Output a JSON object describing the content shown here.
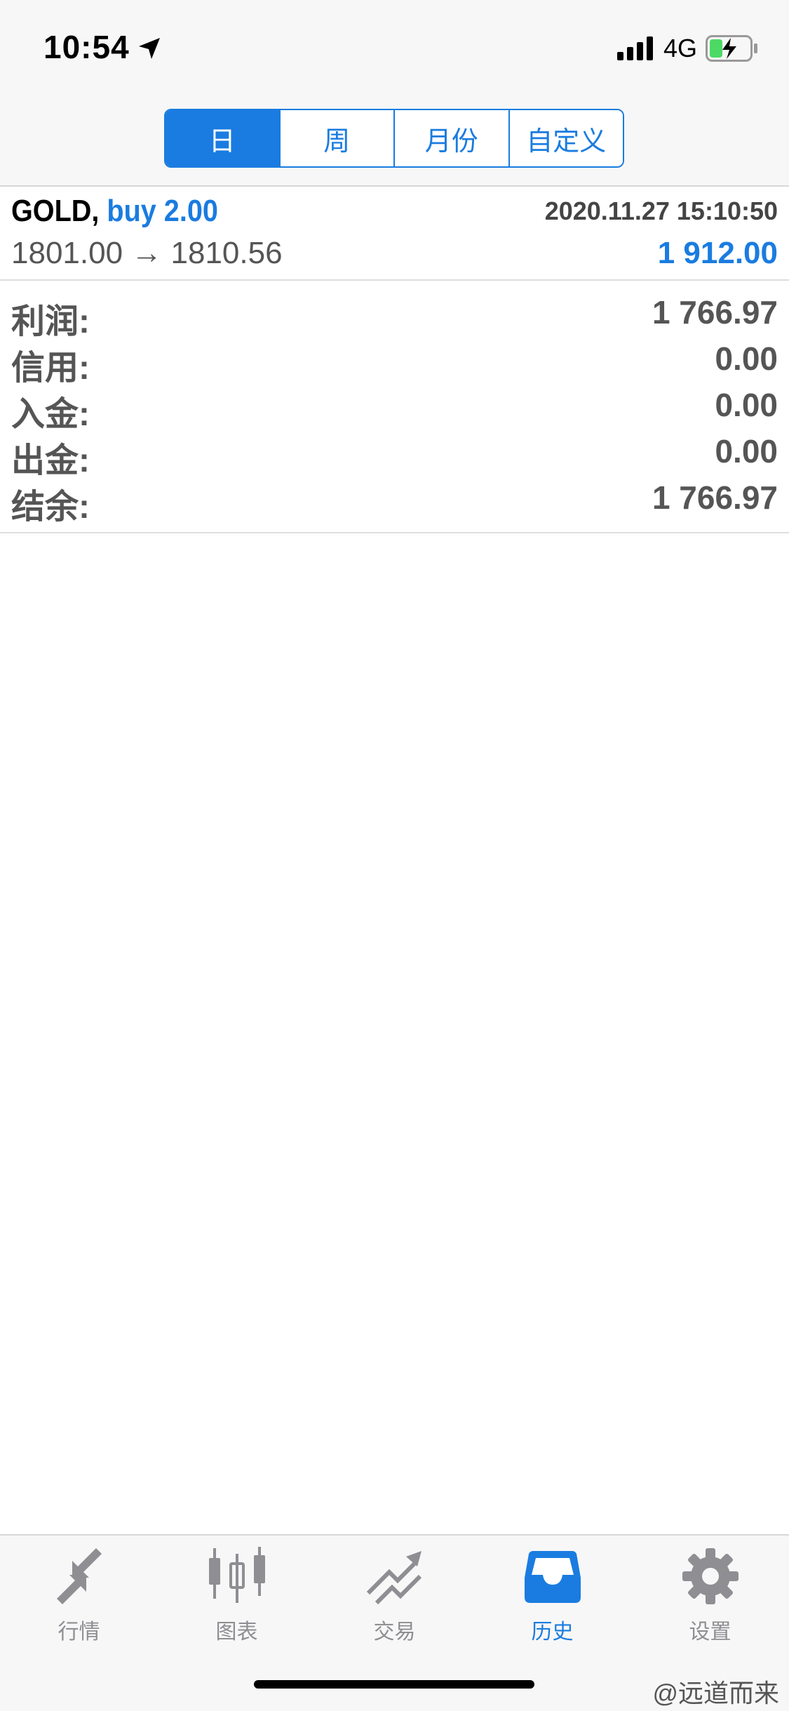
{
  "status_bar": {
    "time": "10:54",
    "network": "4G"
  },
  "segments": [
    {
      "label": "日",
      "active": true
    },
    {
      "label": "周",
      "active": false
    },
    {
      "label": "月份",
      "active": false
    },
    {
      "label": "自定义",
      "active": false
    }
  ],
  "deal": {
    "symbol": "GOLD,",
    "type": "buy 2.00",
    "time": "2020.11.27 15:10:50",
    "prices": "1801.00 → 1810.56",
    "profit": "1 912.00"
  },
  "summary": [
    {
      "label": "利润:",
      "value": "1 766.97"
    },
    {
      "label": "信用:",
      "value": "0.00"
    },
    {
      "label": "入金:",
      "value": "0.00"
    },
    {
      "label": "出金:",
      "value": "0.00"
    },
    {
      "label": "结余:",
      "value": "1 766.97"
    }
  ],
  "tabs": [
    {
      "label": "行情",
      "icon": "quotes-arrows-icon",
      "active": false
    },
    {
      "label": "图表",
      "icon": "candlestick-chart-icon",
      "active": false
    },
    {
      "label": "交易",
      "icon": "trade-trend-icon",
      "active": false
    },
    {
      "label": "历史",
      "icon": "history-inbox-icon",
      "active": true
    },
    {
      "label": "设置",
      "icon": "settings-gear-icon",
      "active": false
    }
  ],
  "watermark": "@远道而来",
  "colors": {
    "accent": "#1a7ce0",
    "inactive_tab": "#8e8e93",
    "text": "#555555"
  }
}
